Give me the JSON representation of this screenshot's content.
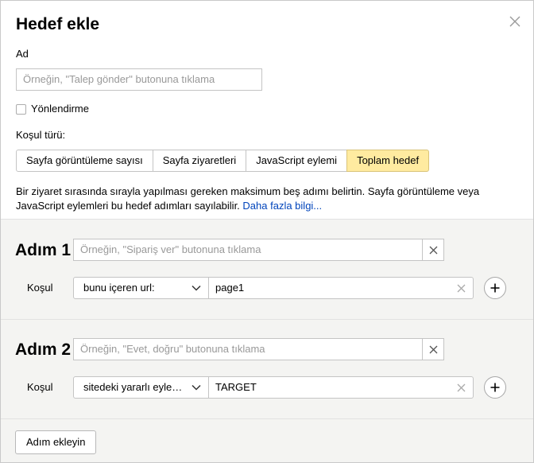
{
  "dialog": {
    "title": "Hedef ekle",
    "close_icon": "close-icon"
  },
  "name_field": {
    "label": "Ad",
    "placeholder": "Örneğin, \"Talep gönder\" butonuna tıklama",
    "value": ""
  },
  "redirect_checkbox": {
    "label": "Yönlendirme",
    "checked": false
  },
  "condition_type": {
    "label": "Koşul türü:",
    "options": [
      "Sayfa görüntüleme sayısı",
      "Sayfa ziyaretleri",
      "JavaScript eylemi",
      "Toplam hedef"
    ],
    "selected": "Toplam hedef"
  },
  "description": {
    "text": "Bir ziyaret sırasında sırayla yapılması gereken maksimum beş adımı belirtin. Sayfa görüntüleme veya JavaScript eylemleri bu hedef adımları sayılabilir.",
    "link": "Daha fazla bilgi..."
  },
  "steps": [
    {
      "title": "Adım 1",
      "placeholder": "Örneğin, \"Sipariş ver\" butonuna tıklama",
      "condition_label": "Koşul",
      "condition_select": "bunu içeren url:",
      "condition_value": "page1"
    },
    {
      "title": "Adım 2",
      "placeholder": "Örneğin, \"Evet, doğru\" butonuna tıklama",
      "condition_label": "Koşul",
      "condition_select": "sitedeki yararlı eyle…",
      "condition_value": "TARGET"
    }
  ],
  "add_step_button": "Adım ekleyin",
  "colors": {
    "active_segment": "#ffeba0",
    "steps_background": "#f4f4f2",
    "link": "#0044bb",
    "placeholder": "#999999"
  }
}
